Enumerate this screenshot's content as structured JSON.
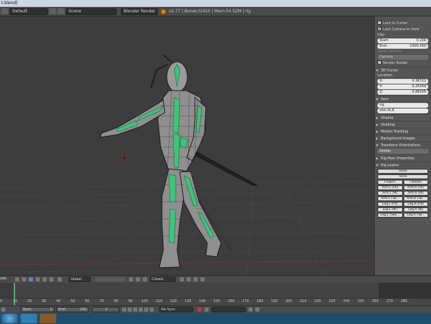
{
  "window": {
    "title": "t.blend]"
  },
  "header": {
    "layout": "Default",
    "scene": "Scene",
    "engine": "Blender Render",
    "stats": "v2.77 | Bones:0/420 | Mem:54.52M | rig"
  },
  "props": {
    "lock_to_cursor": "Lock to Cursor",
    "lock_camera": "Lock Camera to View",
    "clip_label": "Clip:",
    "clip_start_label": "Start:",
    "clip_start": "0.100",
    "clip_end_label": "End:",
    "clip_end": "1000.000",
    "local_camera_label": "Local Camera:",
    "camera": "Camera",
    "render_border": "Render Border",
    "cursor_section": "3D Cursor",
    "location_label": "Location:",
    "x_label": "X:",
    "x_val": "0.36721",
    "y_label": "Y:",
    "y_val": "0.25259",
    "z_label": "Z:",
    "z_val": "0.88305",
    "item_section": "Item",
    "item_name": "rig",
    "bone_name": "shin.fk.R",
    "display": "Display",
    "shading": "Shading",
    "motion_tracking": "Motion Tracking",
    "background_images": "Background Images",
    "transform_orientations": "Transform Orientations",
    "orientation": "Global",
    "rig_main": "Rig Main Properties",
    "rig_layers": "Rig Layers",
    "layers": {
      "head": "Head",
      "torso": "Torso",
      "fingers": "Fingers",
      "tweak": "(Tweak)",
      "arm_l_fk": "Arm.L (FK)",
      "arm_r_fk": "Arm.R (FK)",
      "arm_l_ik": "Arm.L (IK)",
      "arm_r_ik": "Arm.R (IK)",
      "arm_l_tw": "Arm.L (Tw...",
      "arm_r_tw": "Arm.R (Tw...",
      "leg_l_fk": "Leg.L (FK)",
      "leg_r_fk": "Leg.R (FK)",
      "leg_l_ik": "Leg.L (IK)",
      "leg_r_ik": "Leg.R (IK)",
      "leg_l_tw": "Leg.L (Twe...",
      "leg_r_tw": "Leg.R (Tw..."
    }
  },
  "viewfooter": {
    "mode": "ode",
    "orientation": "Global",
    "proportional": "Closed"
  },
  "timeline": {
    "ticks": [
      "0",
      "10",
      "20",
      "30",
      "40",
      "50",
      "60",
      "70",
      "80",
      "90",
      "100",
      "110",
      "120",
      "130",
      "140",
      "150",
      "160",
      "170",
      "180",
      "190",
      "200",
      "210",
      "220",
      "230",
      "240",
      "250",
      "260",
      "270",
      "280"
    ],
    "start_label": "Start:",
    "start": "1",
    "end_label": "End:",
    "end": "250",
    "current": "2",
    "sync": "No Sync"
  },
  "colors": {
    "accent": "#4fb26b",
    "viewport": "#3d3d3d",
    "panel": "#555555"
  }
}
